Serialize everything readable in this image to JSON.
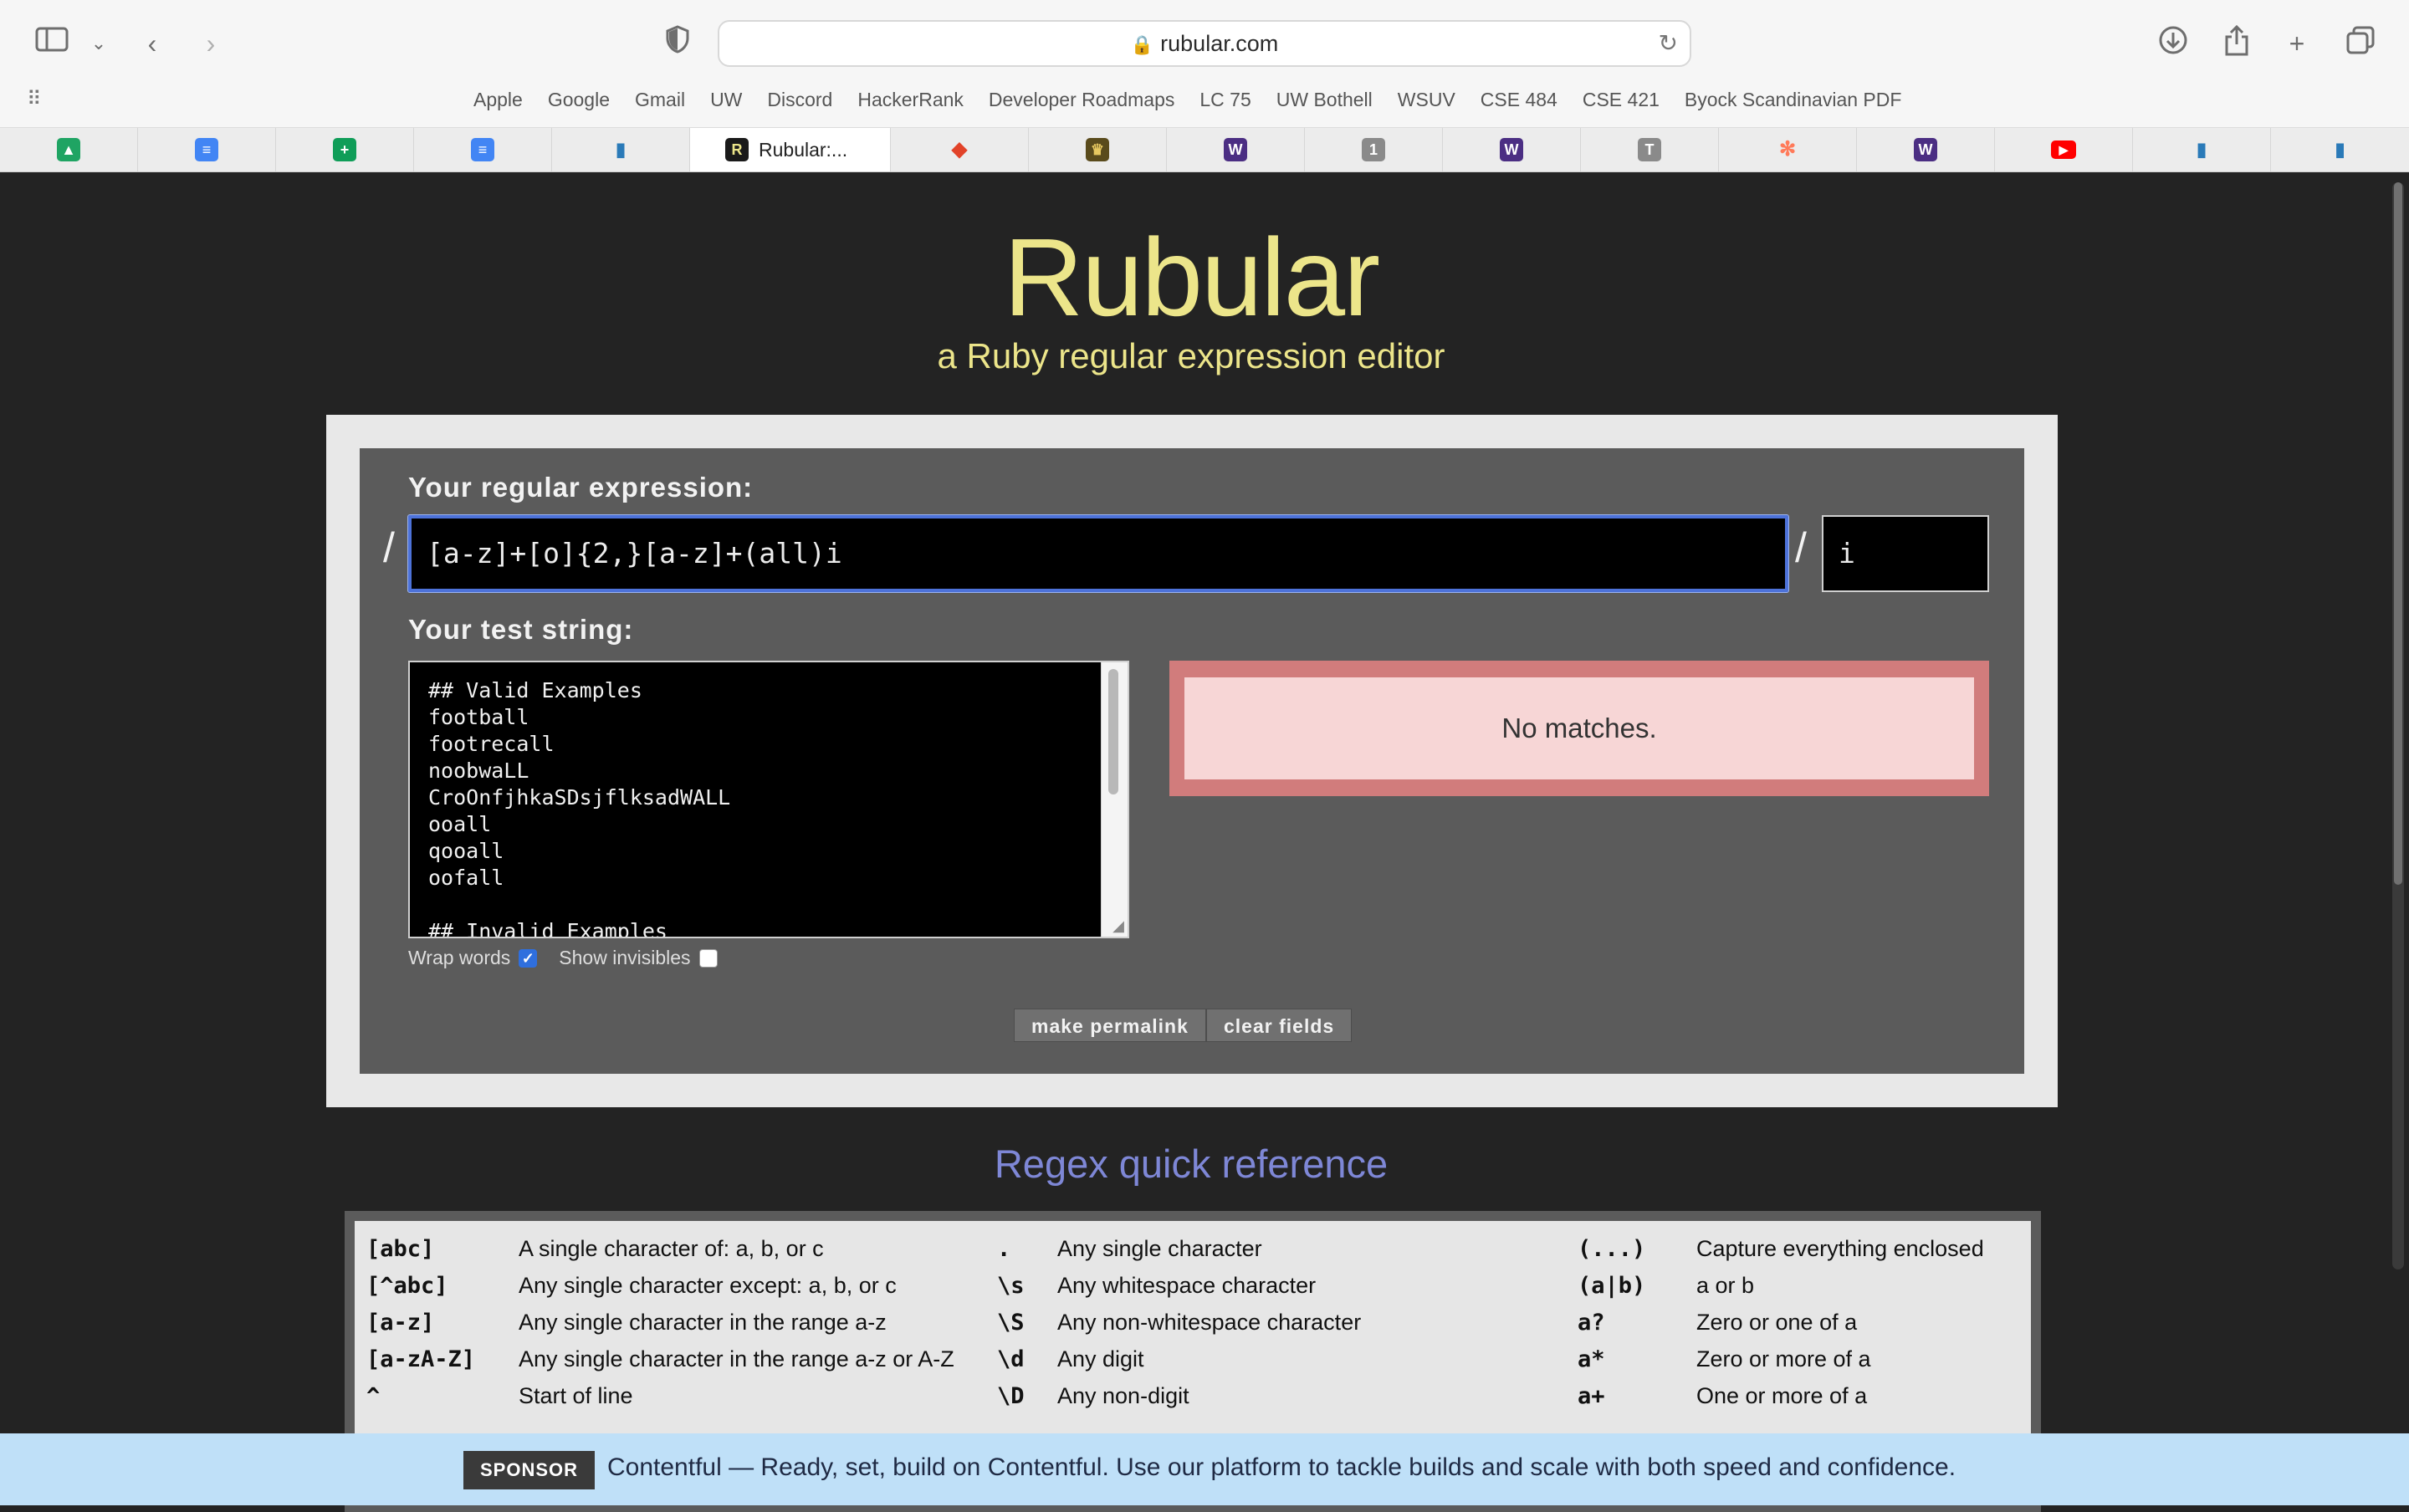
{
  "browser": {
    "url": "rubular.com",
    "favorites": [
      "Apple",
      "Google",
      "Gmail",
      "UW",
      "Discord",
      "HackerRank",
      "Developer Roadmaps",
      "LC 75",
      "UW Bothell",
      "WSUV",
      "CSE 484",
      "CSE 421",
      "Byock Scandinavian PDF"
    ],
    "active_tab_title": "Rubular:..."
  },
  "site": {
    "title": "Rubular",
    "tagline": "a Ruby regular expression editor"
  },
  "editor": {
    "regex_label": "Your regular expression:",
    "slash": "/",
    "regex_value": "[a-z]+[o]{2,}[a-z]+(all)i",
    "options_value": "i",
    "test_label": "Your test string:",
    "test_lines": [
      "## Valid Examples",
      "football",
      "footrecall",
      "noobwaLL",
      "CroOnfjhkaSDsjflksadWALL",
      "ooall",
      "qooall",
      "oofall",
      "",
      "## Invalid Examples"
    ],
    "result": "No matches.",
    "wrap_words_label": "Wrap words",
    "wrap_words_checked": true,
    "show_invisibles_label": "Show invisibles",
    "show_invisibles_checked": false,
    "permalink_label": "make permalink",
    "clear_label": "clear fields"
  },
  "reference": {
    "title": "Regex quick reference",
    "rows": [
      [
        [
          "[abc]",
          "A single character of: a, b, or c"
        ],
        [
          ".",
          "Any single character"
        ],
        [
          "(...)",
          "Capture everything enclosed"
        ]
      ],
      [
        [
          "[^abc]",
          "Any single character except: a, b, or c"
        ],
        [
          "\\s",
          "Any whitespace character"
        ],
        [
          "(a|b)",
          "a or b"
        ]
      ],
      [
        [
          "[a-z]",
          "Any single character in the range a-z"
        ],
        [
          "\\S",
          "Any non-whitespace character"
        ],
        [
          "a?",
          "Zero or one of a"
        ]
      ],
      [
        [
          "[a-zA-Z]",
          "Any single character in the range a-z or A-Z"
        ],
        [
          "\\d",
          "Any digit"
        ],
        [
          "a*",
          "Zero or more of a"
        ]
      ],
      [
        [
          "^",
          "Start of line"
        ],
        [
          "\\D",
          "Any non-digit"
        ],
        [
          "a+",
          "One or more of a"
        ]
      ]
    ]
  },
  "sponsor": {
    "tag": "SPONSOR",
    "text": "Contentful — Ready, set, build on Contentful. Use our platform to tackle builds and scale with both speed and confidence."
  },
  "colors": {
    "title_yellow": "#ece58a",
    "reference_title_blue": "#7e87d6",
    "no_match_red": "#d17c7c",
    "focus_blue": "#4d72d9"
  }
}
